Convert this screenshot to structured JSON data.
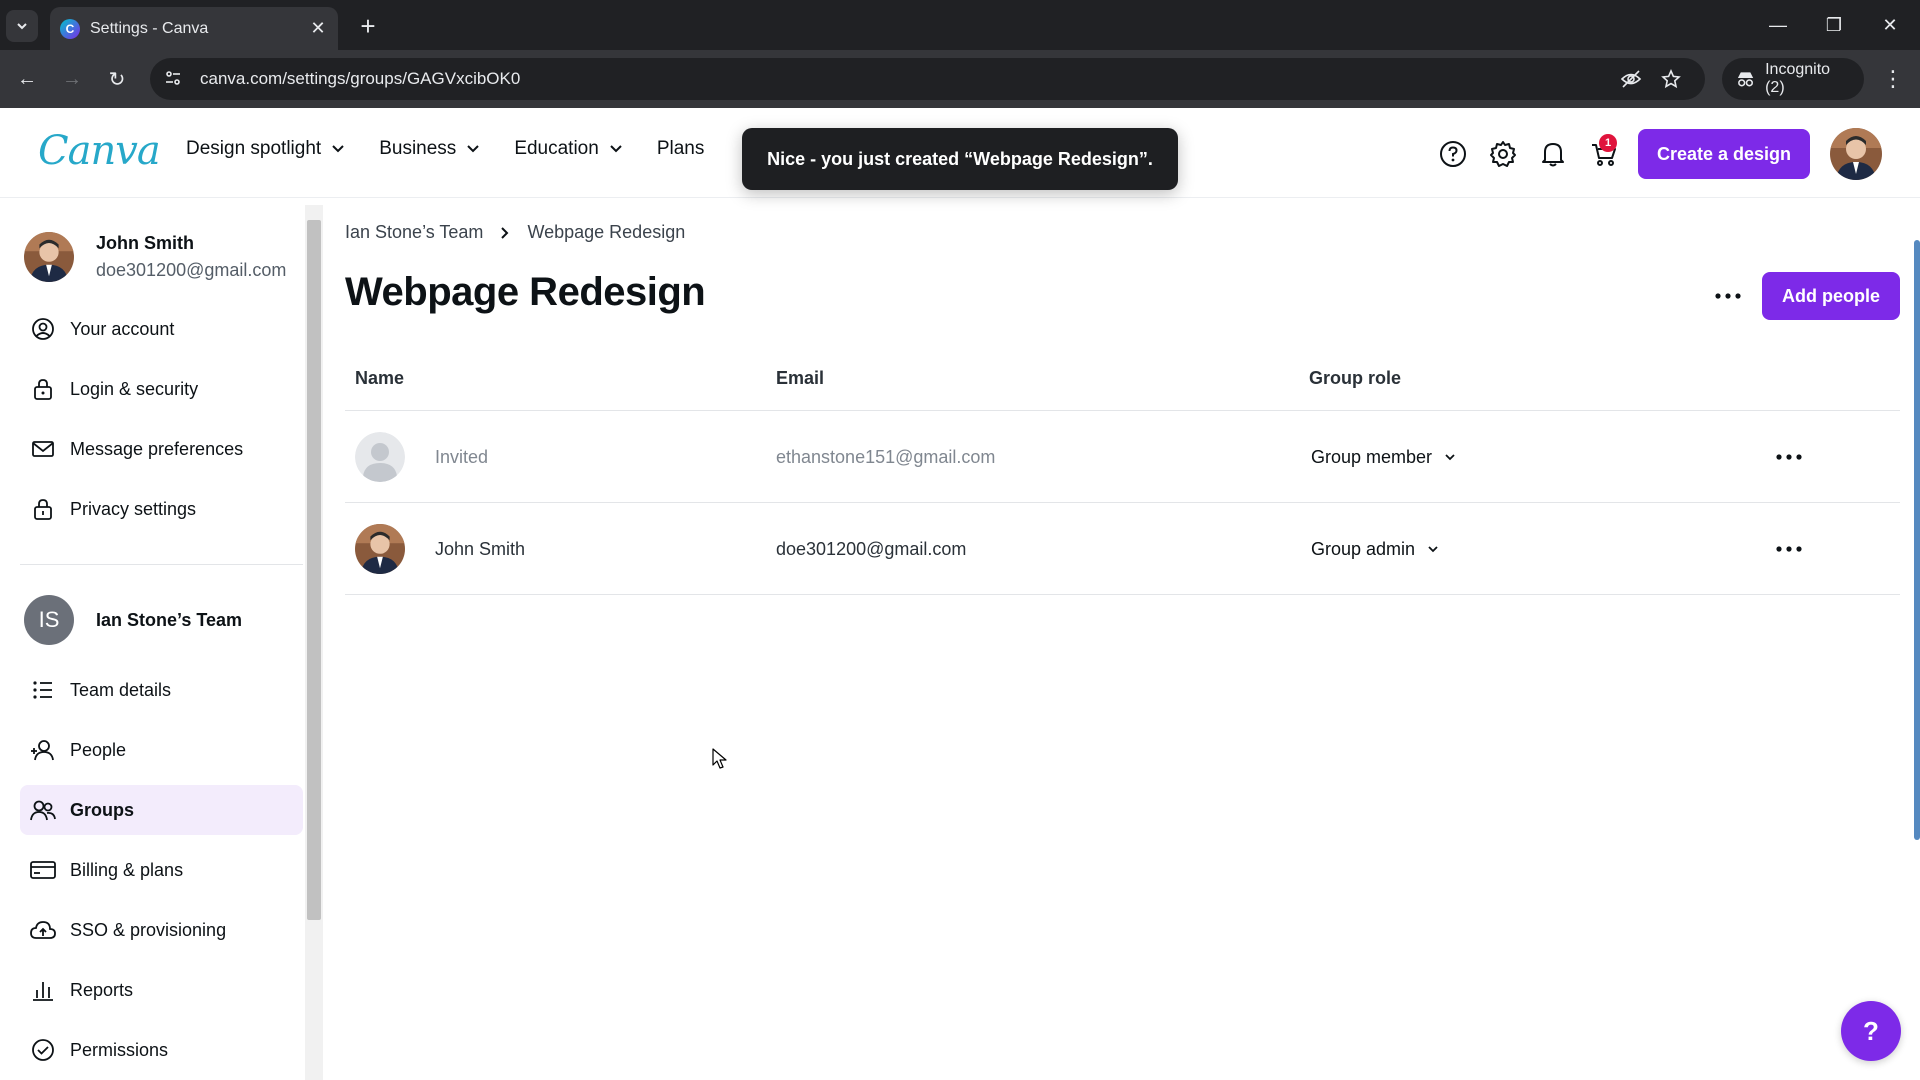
{
  "browser": {
    "tab_title": "Settings - Canva",
    "url": "canva.com/settings/groups/GAGVxcibOK0",
    "incognito_label": "Incognito (2)"
  },
  "header": {
    "logo": "Canva",
    "nav": [
      "Design spotlight",
      "Business",
      "Education",
      "Plans"
    ],
    "cart_count": "1",
    "create_label": "Create a design"
  },
  "toast": {
    "message": "Nice - you just created “Webpage Redesign”."
  },
  "sidebar": {
    "user_name": "John Smith",
    "user_email": "doe301200@gmail.com",
    "account_items": [
      {
        "label": "Your account",
        "icon": "user-circle-icon"
      },
      {
        "label": "Login & security",
        "icon": "lock-icon"
      },
      {
        "label": "Message preferences",
        "icon": "envelope-icon"
      },
      {
        "label": "Privacy settings",
        "icon": "privacy-lock-icon"
      }
    ],
    "team_initials": "IS",
    "team_name": "Ian Stone’s Team",
    "team_items": [
      {
        "label": "Team details",
        "icon": "list-icon"
      },
      {
        "label": "People",
        "icon": "people-icon"
      },
      {
        "label": "Groups",
        "icon": "groups-icon",
        "active": true
      },
      {
        "label": "Billing & plans",
        "icon": "card-icon"
      },
      {
        "label": "SSO & provisioning",
        "icon": "cloud-icon"
      },
      {
        "label": "Reports",
        "icon": "bar-chart-icon"
      },
      {
        "label": "Permissions",
        "icon": "check-circle-icon"
      }
    ]
  },
  "main": {
    "breadcrumb": [
      "Ian Stone’s Team",
      "Webpage Redesign"
    ],
    "title": "Webpage Redesign",
    "add_people_label": "Add people",
    "columns": [
      "Name",
      "Email",
      "Group role"
    ],
    "rows": [
      {
        "name": "Invited",
        "email": "ethanstone151@gmail.com",
        "role": "Group member",
        "invited": true
      },
      {
        "name": "John Smith",
        "email": "doe301200@gmail.com",
        "role": "Group admin",
        "invited": false
      }
    ]
  },
  "help_fab": "?",
  "colors": {
    "brand_purple": "#7d2ae8",
    "active_bg": "#f3ecfc"
  }
}
